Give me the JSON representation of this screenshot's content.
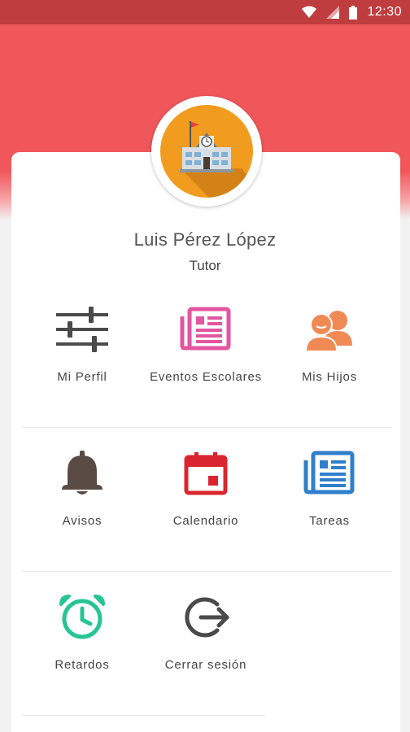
{
  "status_bar": {
    "time": "12:30",
    "icons": [
      "wifi-icon",
      "signal-icon",
      "battery-icon"
    ]
  },
  "colors": {
    "header": "#f0575a",
    "status_bar": "#bf3c3f",
    "perfil": "#4a4a4a",
    "eventos": "#e2559f",
    "hijos": "#f08a55",
    "avisos": "#5a4a44",
    "calendario": "#d9262e",
    "tareas": "#2f7fcb",
    "retardos": "#26c595",
    "cerrar": "#4a4a4a"
  },
  "profile": {
    "avatar_icon": "school-icon",
    "name": "Luis Pérez López",
    "role": "Tutor"
  },
  "menu": [
    {
      "label": "Mi Perfil",
      "icon": "sliders-icon"
    },
    {
      "label": "Eventos Escolares",
      "icon": "newspaper-icon"
    },
    {
      "label": "Mis Hijos",
      "icon": "people-icon"
    },
    {
      "label": "Avisos",
      "icon": "bell-icon"
    },
    {
      "label": "Calendario",
      "icon": "calendar-icon"
    },
    {
      "label": "Tareas",
      "icon": "tasks-icon"
    },
    {
      "label": "Retardos",
      "icon": "alarm-clock-icon"
    },
    {
      "label": "Cerrar sesión",
      "icon": "logout-icon"
    }
  ]
}
